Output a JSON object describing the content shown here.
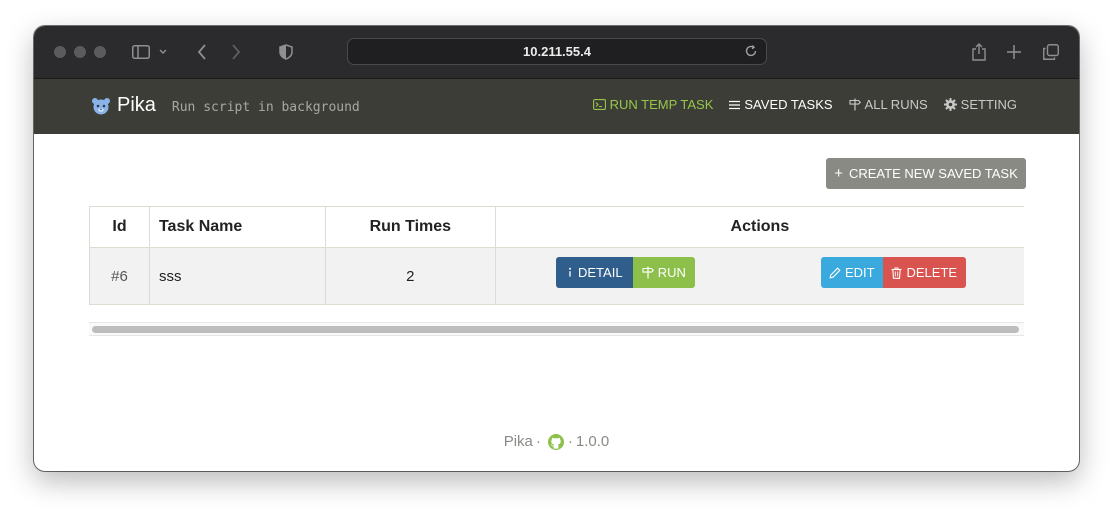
{
  "browser": {
    "url": "10.211.55.4"
  },
  "app": {
    "name": "Pika",
    "tagline": "Run script in background"
  },
  "nav": {
    "run_temp_task": "RUN TEMP TASK",
    "saved_tasks": "SAVED TASKS",
    "all_runs": "ALL RUNS",
    "setting": "SETTING"
  },
  "main": {
    "create_button": "CREATE NEW SAVED TASK",
    "table": {
      "headers": [
        "Id",
        "Task Name",
        "Run Times",
        "Actions"
      ],
      "rows": [
        {
          "id": "#6",
          "name": "sss",
          "run_times": "2"
        }
      ]
    },
    "actions": {
      "detail": "DETAIL",
      "run": "RUN",
      "edit": "EDIT",
      "delete": "DELETE"
    }
  },
  "footer": {
    "name": "Pika",
    "sep": "·",
    "version": "1.0.0"
  },
  "colors": {
    "navbar": "#3c3d37",
    "accent_green": "#97c64a",
    "detail": "#2f5d8c",
    "run": "#8cc04b",
    "edit": "#3aa9dd",
    "delete": "#d9534f",
    "create": "#8a8a85"
  },
  "icons": [
    "sidebar-icon",
    "chevron-down-icon",
    "back-icon",
    "forward-icon",
    "shield-icon",
    "reload-icon",
    "share-icon",
    "new-tab-icon",
    "tabs-icon",
    "bear-logo-icon",
    "terminal-icon",
    "list-icon",
    "signpost-icon",
    "gear-icon",
    "plus-icon",
    "info-icon",
    "pencil-icon",
    "trash-icon",
    "github-icon"
  ]
}
